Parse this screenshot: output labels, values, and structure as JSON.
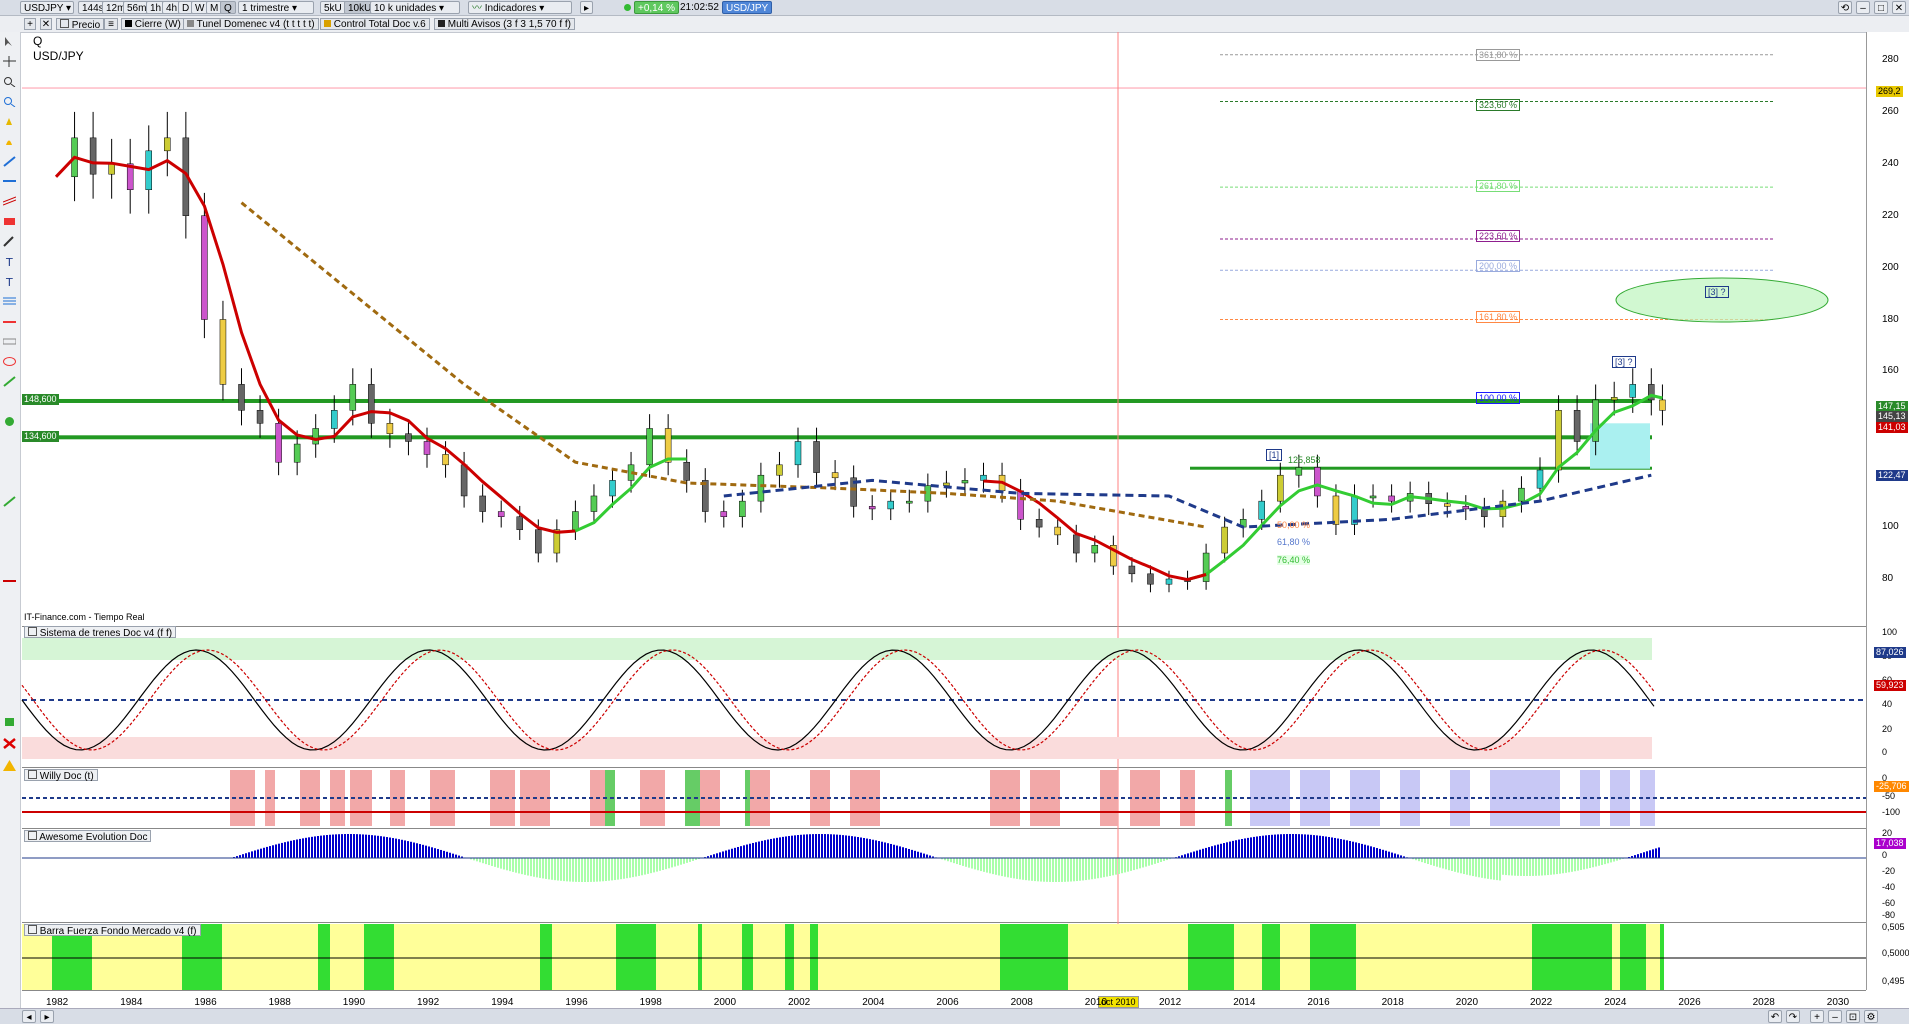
{
  "toolbar": {
    "symbol": "USDJPY",
    "timeframes": [
      "144s",
      "12m",
      "56m",
      "1h",
      "4h",
      "D",
      "W",
      "M",
      "Q"
    ],
    "active_timeframe": "Q",
    "period": "1 trimestre",
    "size_buttons": [
      "5kU",
      "10kU"
    ],
    "units": "10 k unidades",
    "indicators_label": "Indicadores",
    "change": "+0,14 %",
    "time": "21:02:52",
    "instrument_tab": "USD/JPY"
  },
  "legend_bar": {
    "items": [
      "Precio",
      "Cierre (W)",
      "Tunel Domenec v4 (t t t t t)",
      "Control Total Doc v.6",
      "Multi Avisos (3 f 3 1,5 70 f f)"
    ]
  },
  "main_chart": {
    "period_label": "Q",
    "instrument": "USD/JPY",
    "source": "IT-Finance.com - Tiempo Real",
    "y_ticks": [
      "280",
      "260",
      "240",
      "220",
      "200",
      "180",
      "160",
      "140",
      "120",
      "100",
      "80"
    ],
    "price_tags": [
      {
        "text": "269,2",
        "color": "#e8c800"
      },
      {
        "text": "147,15",
        "color": "#2a8a2a"
      },
      {
        "text": "145,13",
        "color": "#444"
      },
      {
        "text": "141,03",
        "color": "#c00"
      },
      {
        "text": "122,47",
        "color": "#1f3a8a"
      }
    ],
    "level_labels": [
      {
        "text": "148,600"
      },
      {
        "text": "134,600"
      }
    ],
    "fib_levels": [
      {
        "text": "361,80 %",
        "color": "#999999"
      },
      {
        "text": "323,60 %",
        "color": "#2a7a2a"
      },
      {
        "text": "261,80 %",
        "color": "#77dd77"
      },
      {
        "text": "223,60 %",
        "color": "#8e1e8e"
      },
      {
        "text": "200,00 %",
        "color": "#99aadd"
      },
      {
        "text": "161,80 %",
        "color": "#ff8844"
      },
      {
        "text": "100,00 %",
        "color": "#1a1aff"
      }
    ],
    "wave_labels": [
      "[3] ?",
      "[3] ?",
      "[1]"
    ],
    "peak_value": "125,858",
    "retrace_labels": [
      "50,00 %",
      "61,80 %",
      "76,40 %"
    ],
    "crosshair_date": "oct 2010"
  },
  "x_axis": [
    "1982",
    "1984",
    "1986",
    "1988",
    "1990",
    "1992",
    "1994",
    "1996",
    "1998",
    "2000",
    "2002",
    "2004",
    "2006",
    "2008",
    "2010",
    "2012",
    "2014",
    "2016",
    "2018",
    "2020",
    "2022",
    "2024",
    "2026",
    "2028",
    "2030"
  ],
  "panels": [
    {
      "title": "Sistema de trenes Doc v4 (f f)",
      "y_ticks": [
        "100",
        "80",
        "60",
        "40",
        "20",
        "0"
      ],
      "tags": [
        {
          "text": "87,026",
          "color": "#1f3a8a"
        },
        {
          "text": "59,923",
          "color": "#c00"
        }
      ]
    },
    {
      "title": "Willy Doc (t)",
      "y_ticks": [
        "0",
        "-50",
        "-100"
      ],
      "tags": [
        {
          "text": "-25,706",
          "color": "#ff8800"
        }
      ]
    },
    {
      "title": "Awesome Evolution Doc",
      "y_ticks": [
        "20",
        "0",
        "-20",
        "-40",
        "-60",
        "-80"
      ],
      "tags": [
        {
          "text": "17,038",
          "color": "#aa00cc"
        }
      ]
    },
    {
      "title": "Barra Fuerza Fondo Mercado v4 (f)",
      "y_ticks": [
        "0,505",
        "0,5000",
        "0,495"
      ],
      "tags": []
    }
  ],
  "colors": {
    "bull": "#33cc33",
    "bear": "#cc0000",
    "yellow_band": "#ffff99",
    "green_band": "#33dd33"
  }
}
